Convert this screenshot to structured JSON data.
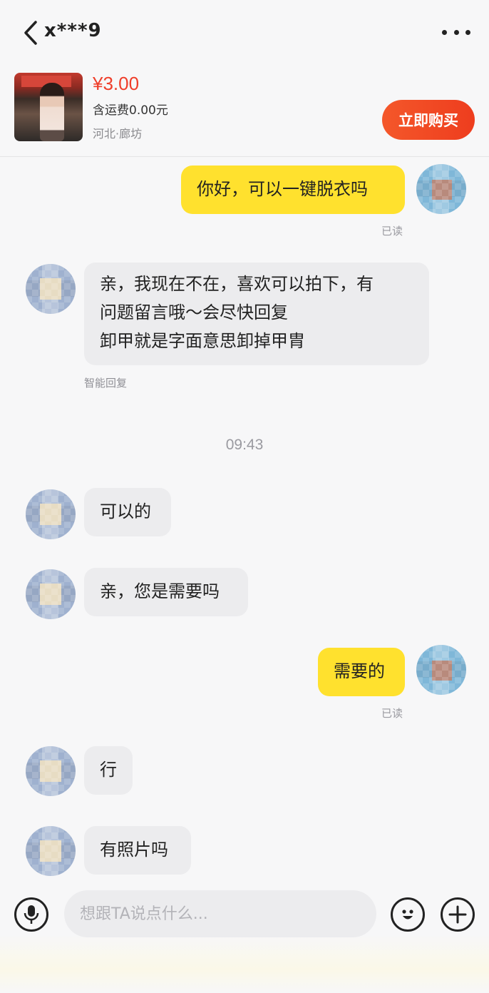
{
  "header": {
    "title": "x***9"
  },
  "product": {
    "price": "¥3.00",
    "shipping": "含运费0.00元",
    "location": "河北·廊坊",
    "buy_label": "立即购买"
  },
  "messages": [
    {
      "side": "mine",
      "text": "你好，可以一键脱衣吗",
      "status": "已读"
    },
    {
      "side": "theirs",
      "text_lines": [
        "亲，我现在不在，喜欢可以拍下，有",
        "问题留言哦～会尽快回复",
        "卸甲就是字面意思卸掉甲胄"
      ],
      "note": "智能回复"
    },
    {
      "side": "theirs",
      "text": "可以的"
    },
    {
      "side": "theirs",
      "text": "亲，您是需要吗"
    },
    {
      "side": "mine",
      "text": "需要的",
      "status": "已读"
    },
    {
      "side": "theirs",
      "text": "行"
    },
    {
      "side": "theirs",
      "text": "有照片吗"
    }
  ],
  "timestamp": "09:43",
  "composer": {
    "placeholder": "想跟TA说点什么..."
  }
}
